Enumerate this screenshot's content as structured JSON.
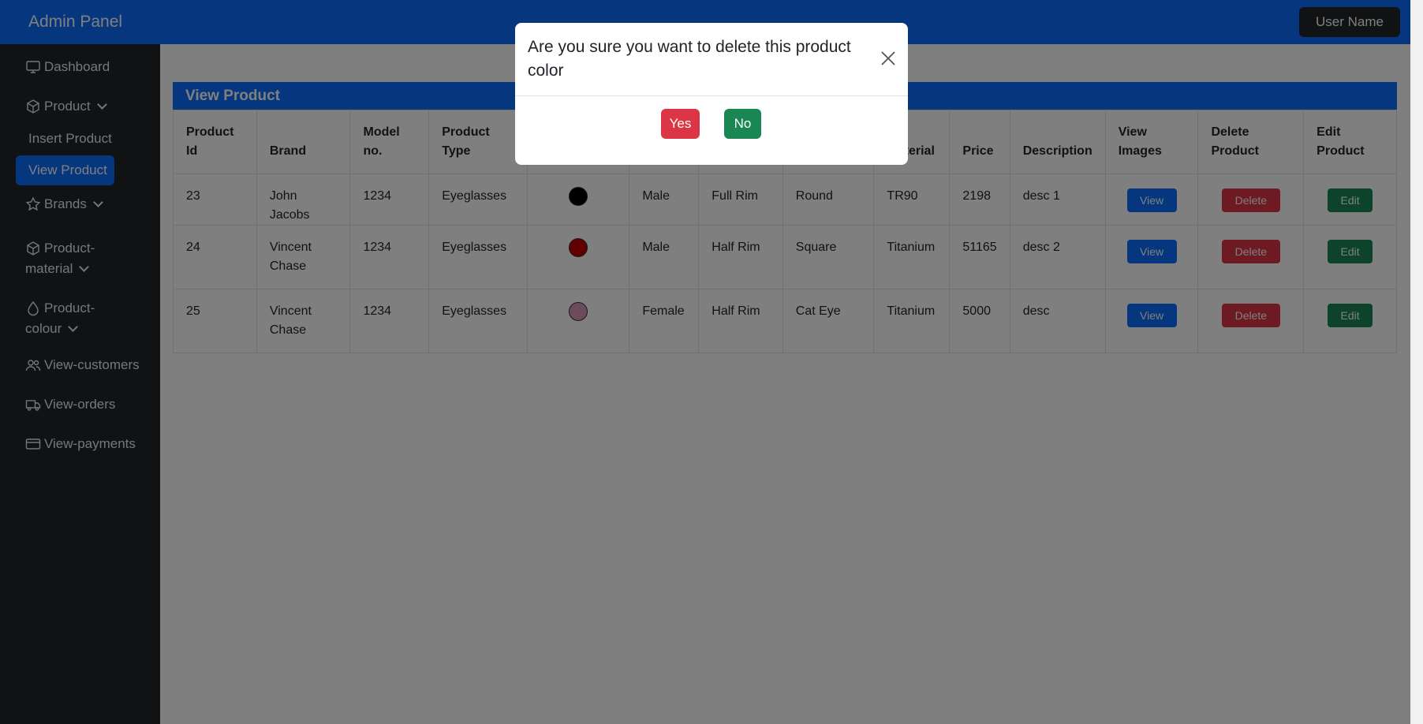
{
  "header": {
    "brand": "Admin Panel",
    "user": "User Name"
  },
  "sidebar": {
    "dashboard": "Dashboard",
    "product": "Product",
    "insert_product": "Insert Product",
    "view_product": "View Product",
    "brands": "Brands",
    "product_material_1": "Product-",
    "product_material_2": "material",
    "product_colour_1": "Product-",
    "product_colour_2": "colour",
    "view_customers": "View-customers",
    "view_orders": "View-orders",
    "view_payments": "View-payments"
  },
  "main": {
    "section_title": "View Product",
    "columns": {
      "id_1": "Product",
      "id_2": "Id",
      "brand": "Brand",
      "model_1": "Model",
      "model_2": "no.",
      "type_1": "Product",
      "type_2": "Type",
      "material": "Material",
      "price": "Price",
      "description": "Description",
      "images_1": "View",
      "images_2": "Images",
      "delete_1": "Delete",
      "delete_2": "Product",
      "edit_1": "Edit",
      "edit_2": "Product"
    },
    "rows": [
      {
        "id": "23",
        "brand": "John Jacobs",
        "model": "1234",
        "type": "Eyeglasses",
        "color": "#000000",
        "gender": "Male",
        "frame": "Full Rim",
        "shape": "Round",
        "material": "TR90",
        "price": "2198",
        "description": "desc 1"
      },
      {
        "id": "24",
        "brand": "Vincent Chase",
        "model": "1234",
        "type": "Eyeglasses",
        "color": "#c00000",
        "gender": "Male",
        "frame": "Half Rim",
        "shape": "Square",
        "material": "Titanium",
        "price": "51165",
        "description": "desc 2"
      },
      {
        "id": "25",
        "brand": "Vincent Chase",
        "model": "1234",
        "type": "Eyeglasses",
        "color": "#d796b8",
        "gender": "Female",
        "frame": "Half Rim",
        "shape": "Cat Eye",
        "material": "Titanium",
        "price": "5000",
        "description": "desc"
      }
    ],
    "buttons": {
      "view": "View",
      "delete": "Delete",
      "edit": "Edit"
    }
  },
  "modal": {
    "title": "Are you sure you want to delete this product color",
    "yes": "Yes",
    "no": "No"
  },
  "colors": {
    "primary": "#0d6efd",
    "dark": "#212529",
    "danger": "#dc3545",
    "success": "#198754"
  }
}
